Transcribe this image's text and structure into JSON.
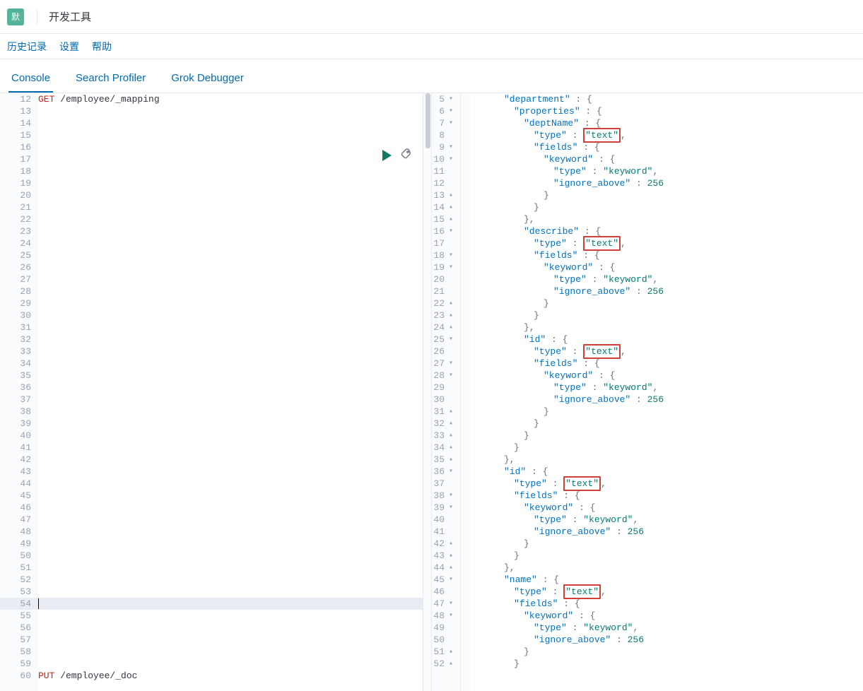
{
  "window": {
    "logo_text": "默",
    "title": "开发工具"
  },
  "menu": {
    "history": "历史记录",
    "settings": "设置",
    "help": "帮助"
  },
  "tabs": {
    "console": "Console",
    "profiler": "Search Profiler",
    "grok": "Grok Debugger"
  },
  "editor": {
    "first_line_no": 12,
    "request_method": "GET",
    "request_path": " /employee/_mapping",
    "current_line_no": 54,
    "last_method": "PUT",
    "last_path": " /employee/_doc",
    "line_count": 49
  },
  "output": {
    "lines": [
      {
        "n": 5,
        "f": "▾",
        "ind": 3,
        "tokens": [
          {
            "t": "\"department\"",
            "c": "jkey"
          },
          {
            "t": " : ",
            "c": "jpunc"
          },
          {
            "t": "{",
            "c": "jpunc"
          }
        ]
      },
      {
        "n": 6,
        "f": "▾",
        "ind": 4,
        "tokens": [
          {
            "t": "\"properties\"",
            "c": "jkey"
          },
          {
            "t": " : ",
            "c": "jpunc"
          },
          {
            "t": "{",
            "c": "jpunc"
          }
        ]
      },
      {
        "n": 7,
        "f": "▾",
        "ind": 5,
        "tokens": [
          {
            "t": "\"deptName\"",
            "c": "jkey"
          },
          {
            "t": " : ",
            "c": "jpunc"
          },
          {
            "t": "{",
            "c": "jpunc"
          }
        ]
      },
      {
        "n": 8,
        "f": "",
        "ind": 6,
        "tokens": [
          {
            "t": "\"type\"",
            "c": "jkey"
          },
          {
            "t": " : ",
            "c": "jpunc"
          },
          {
            "t": "\"text\"",
            "c": "jval",
            "hl": true
          },
          {
            "t": ",",
            "c": "jpunc"
          }
        ]
      },
      {
        "n": 9,
        "f": "▾",
        "ind": 6,
        "tokens": [
          {
            "t": "\"fields\"",
            "c": "jkey"
          },
          {
            "t": " : ",
            "c": "jpunc"
          },
          {
            "t": "{",
            "c": "jpunc"
          }
        ]
      },
      {
        "n": 10,
        "f": "▾",
        "ind": 7,
        "tokens": [
          {
            "t": "\"keyword\"",
            "c": "jkey"
          },
          {
            "t": " : ",
            "c": "jpunc"
          },
          {
            "t": "{",
            "c": "jpunc"
          }
        ]
      },
      {
        "n": 11,
        "f": "",
        "ind": 8,
        "tokens": [
          {
            "t": "\"type\"",
            "c": "jkey"
          },
          {
            "t": " : ",
            "c": "jpunc"
          },
          {
            "t": "\"keyword\"",
            "c": "jval"
          },
          {
            "t": ",",
            "c": "jpunc"
          }
        ]
      },
      {
        "n": 12,
        "f": "",
        "ind": 8,
        "tokens": [
          {
            "t": "\"ignore_above\"",
            "c": "jkey"
          },
          {
            "t": " : ",
            "c": "jpunc"
          },
          {
            "t": "256",
            "c": "jnum"
          }
        ]
      },
      {
        "n": 13,
        "f": "▴",
        "ind": 7,
        "tokens": [
          {
            "t": "}",
            "c": "jpunc"
          }
        ]
      },
      {
        "n": 14,
        "f": "▴",
        "ind": 6,
        "tokens": [
          {
            "t": "}",
            "c": "jpunc"
          }
        ]
      },
      {
        "n": 15,
        "f": "▴",
        "ind": 5,
        "tokens": [
          {
            "t": "},",
            "c": "jpunc"
          }
        ]
      },
      {
        "n": 16,
        "f": "▾",
        "ind": 5,
        "tokens": [
          {
            "t": "\"describe\"",
            "c": "jkey"
          },
          {
            "t": " : ",
            "c": "jpunc"
          },
          {
            "t": "{",
            "c": "jpunc"
          }
        ]
      },
      {
        "n": 17,
        "f": "",
        "ind": 6,
        "tokens": [
          {
            "t": "\"type\"",
            "c": "jkey"
          },
          {
            "t": " : ",
            "c": "jpunc"
          },
          {
            "t": "\"text\"",
            "c": "jval",
            "hl": true
          },
          {
            "t": ",",
            "c": "jpunc"
          }
        ]
      },
      {
        "n": 18,
        "f": "▾",
        "ind": 6,
        "tokens": [
          {
            "t": "\"fields\"",
            "c": "jkey"
          },
          {
            "t": " : ",
            "c": "jpunc"
          },
          {
            "t": "{",
            "c": "jpunc"
          }
        ]
      },
      {
        "n": 19,
        "f": "▾",
        "ind": 7,
        "tokens": [
          {
            "t": "\"keyword\"",
            "c": "jkey"
          },
          {
            "t": " : ",
            "c": "jpunc"
          },
          {
            "t": "{",
            "c": "jpunc"
          }
        ]
      },
      {
        "n": 20,
        "f": "",
        "ind": 8,
        "tokens": [
          {
            "t": "\"type\"",
            "c": "jkey"
          },
          {
            "t": " : ",
            "c": "jpunc"
          },
          {
            "t": "\"keyword\"",
            "c": "jval"
          },
          {
            "t": ",",
            "c": "jpunc"
          }
        ]
      },
      {
        "n": 21,
        "f": "",
        "ind": 8,
        "tokens": [
          {
            "t": "\"ignore_above\"",
            "c": "jkey"
          },
          {
            "t": " : ",
            "c": "jpunc"
          },
          {
            "t": "256",
            "c": "jnum"
          }
        ]
      },
      {
        "n": 22,
        "f": "▴",
        "ind": 7,
        "tokens": [
          {
            "t": "}",
            "c": "jpunc"
          }
        ]
      },
      {
        "n": 23,
        "f": "▴",
        "ind": 6,
        "tokens": [
          {
            "t": "}",
            "c": "jpunc"
          }
        ]
      },
      {
        "n": 24,
        "f": "▴",
        "ind": 5,
        "tokens": [
          {
            "t": "},",
            "c": "jpunc"
          }
        ]
      },
      {
        "n": 25,
        "f": "▾",
        "ind": 5,
        "tokens": [
          {
            "t": "\"id\"",
            "c": "jkey"
          },
          {
            "t": " : ",
            "c": "jpunc"
          },
          {
            "t": "{",
            "c": "jpunc"
          }
        ]
      },
      {
        "n": 26,
        "f": "",
        "ind": 6,
        "tokens": [
          {
            "t": "\"type\"",
            "c": "jkey"
          },
          {
            "t": " : ",
            "c": "jpunc"
          },
          {
            "t": "\"text\"",
            "c": "jval",
            "hl": true
          },
          {
            "t": ",",
            "c": "jpunc"
          }
        ]
      },
      {
        "n": 27,
        "f": "▾",
        "ind": 6,
        "tokens": [
          {
            "t": "\"fields\"",
            "c": "jkey"
          },
          {
            "t": " : ",
            "c": "jpunc"
          },
          {
            "t": "{",
            "c": "jpunc"
          }
        ]
      },
      {
        "n": 28,
        "f": "▾",
        "ind": 7,
        "tokens": [
          {
            "t": "\"keyword\"",
            "c": "jkey"
          },
          {
            "t": " : ",
            "c": "jpunc"
          },
          {
            "t": "{",
            "c": "jpunc"
          }
        ]
      },
      {
        "n": 29,
        "f": "",
        "ind": 8,
        "tokens": [
          {
            "t": "\"type\"",
            "c": "jkey"
          },
          {
            "t": " : ",
            "c": "jpunc"
          },
          {
            "t": "\"keyword\"",
            "c": "jval"
          },
          {
            "t": ",",
            "c": "jpunc"
          }
        ]
      },
      {
        "n": 30,
        "f": "",
        "ind": 8,
        "tokens": [
          {
            "t": "\"ignore_above\"",
            "c": "jkey"
          },
          {
            "t": " : ",
            "c": "jpunc"
          },
          {
            "t": "256",
            "c": "jnum"
          }
        ]
      },
      {
        "n": 31,
        "f": "▴",
        "ind": 7,
        "tokens": [
          {
            "t": "}",
            "c": "jpunc"
          }
        ]
      },
      {
        "n": 32,
        "f": "▴",
        "ind": 6,
        "tokens": [
          {
            "t": "}",
            "c": "jpunc"
          }
        ]
      },
      {
        "n": 33,
        "f": "▴",
        "ind": 5,
        "tokens": [
          {
            "t": "}",
            "c": "jpunc"
          }
        ]
      },
      {
        "n": 34,
        "f": "▴",
        "ind": 4,
        "tokens": [
          {
            "t": "}",
            "c": "jpunc"
          }
        ]
      },
      {
        "n": 35,
        "f": "▴",
        "ind": 3,
        "tokens": [
          {
            "t": "},",
            "c": "jpunc"
          }
        ]
      },
      {
        "n": 36,
        "f": "▾",
        "ind": 3,
        "tokens": [
          {
            "t": "\"id\"",
            "c": "jkey"
          },
          {
            "t": " : ",
            "c": "jpunc"
          },
          {
            "t": "{",
            "c": "jpunc"
          }
        ]
      },
      {
        "n": 37,
        "f": "",
        "ind": 4,
        "tokens": [
          {
            "t": "\"type\"",
            "c": "jkey"
          },
          {
            "t": " : ",
            "c": "jpunc"
          },
          {
            "t": "\"text\"",
            "c": "jval",
            "hl": true
          },
          {
            "t": ",",
            "c": "jpunc"
          }
        ]
      },
      {
        "n": 38,
        "f": "▾",
        "ind": 4,
        "tokens": [
          {
            "t": "\"fields\"",
            "c": "jkey"
          },
          {
            "t": " : ",
            "c": "jpunc"
          },
          {
            "t": "{",
            "c": "jpunc"
          }
        ]
      },
      {
        "n": 39,
        "f": "▾",
        "ind": 5,
        "tokens": [
          {
            "t": "\"keyword\"",
            "c": "jkey"
          },
          {
            "t": " : ",
            "c": "jpunc"
          },
          {
            "t": "{",
            "c": "jpunc"
          }
        ]
      },
      {
        "n": 40,
        "f": "",
        "ind": 6,
        "tokens": [
          {
            "t": "\"type\"",
            "c": "jkey"
          },
          {
            "t": " : ",
            "c": "jpunc"
          },
          {
            "t": "\"keyword\"",
            "c": "jval"
          },
          {
            "t": ",",
            "c": "jpunc"
          }
        ]
      },
      {
        "n": 41,
        "f": "",
        "ind": 6,
        "tokens": [
          {
            "t": "\"ignore_above\"",
            "c": "jkey"
          },
          {
            "t": " : ",
            "c": "jpunc"
          },
          {
            "t": "256",
            "c": "jnum"
          }
        ]
      },
      {
        "n": 42,
        "f": "▴",
        "ind": 5,
        "tokens": [
          {
            "t": "}",
            "c": "jpunc"
          }
        ]
      },
      {
        "n": 43,
        "f": "▴",
        "ind": 4,
        "tokens": [
          {
            "t": "}",
            "c": "jpunc"
          }
        ]
      },
      {
        "n": 44,
        "f": "▴",
        "ind": 3,
        "tokens": [
          {
            "t": "},",
            "c": "jpunc"
          }
        ]
      },
      {
        "n": 45,
        "f": "▾",
        "ind": 3,
        "tokens": [
          {
            "t": "\"name\"",
            "c": "jkey"
          },
          {
            "t": " : ",
            "c": "jpunc"
          },
          {
            "t": "{",
            "c": "jpunc"
          }
        ]
      },
      {
        "n": 46,
        "f": "",
        "ind": 4,
        "tokens": [
          {
            "t": "\"type\"",
            "c": "jkey"
          },
          {
            "t": " : ",
            "c": "jpunc"
          },
          {
            "t": "\"text\"",
            "c": "jval",
            "hl": true
          },
          {
            "t": ",",
            "c": "jpunc"
          }
        ]
      },
      {
        "n": 47,
        "f": "▾",
        "ind": 4,
        "tokens": [
          {
            "t": "\"fields\"",
            "c": "jkey"
          },
          {
            "t": " : ",
            "c": "jpunc"
          },
          {
            "t": "{",
            "c": "jpunc"
          }
        ]
      },
      {
        "n": 48,
        "f": "▾",
        "ind": 5,
        "tokens": [
          {
            "t": "\"keyword\"",
            "c": "jkey"
          },
          {
            "t": " : ",
            "c": "jpunc"
          },
          {
            "t": "{",
            "c": "jpunc"
          }
        ]
      },
      {
        "n": 49,
        "f": "",
        "ind": 6,
        "tokens": [
          {
            "t": "\"type\"",
            "c": "jkey"
          },
          {
            "t": " : ",
            "c": "jpunc"
          },
          {
            "t": "\"keyword\"",
            "c": "jval"
          },
          {
            "t": ",",
            "c": "jpunc"
          }
        ]
      },
      {
        "n": 50,
        "f": "",
        "ind": 6,
        "tokens": [
          {
            "t": "\"ignore_above\"",
            "c": "jkey"
          },
          {
            "t": " : ",
            "c": "jpunc"
          },
          {
            "t": "256",
            "c": "jnum"
          }
        ]
      },
      {
        "n": 51,
        "f": "▴",
        "ind": 5,
        "tokens": [
          {
            "t": "}",
            "c": "jpunc"
          }
        ]
      },
      {
        "n": 52,
        "f": "▴",
        "ind": 4,
        "tokens": [
          {
            "t": "}",
            "c": "jpunc"
          }
        ]
      }
    ]
  }
}
